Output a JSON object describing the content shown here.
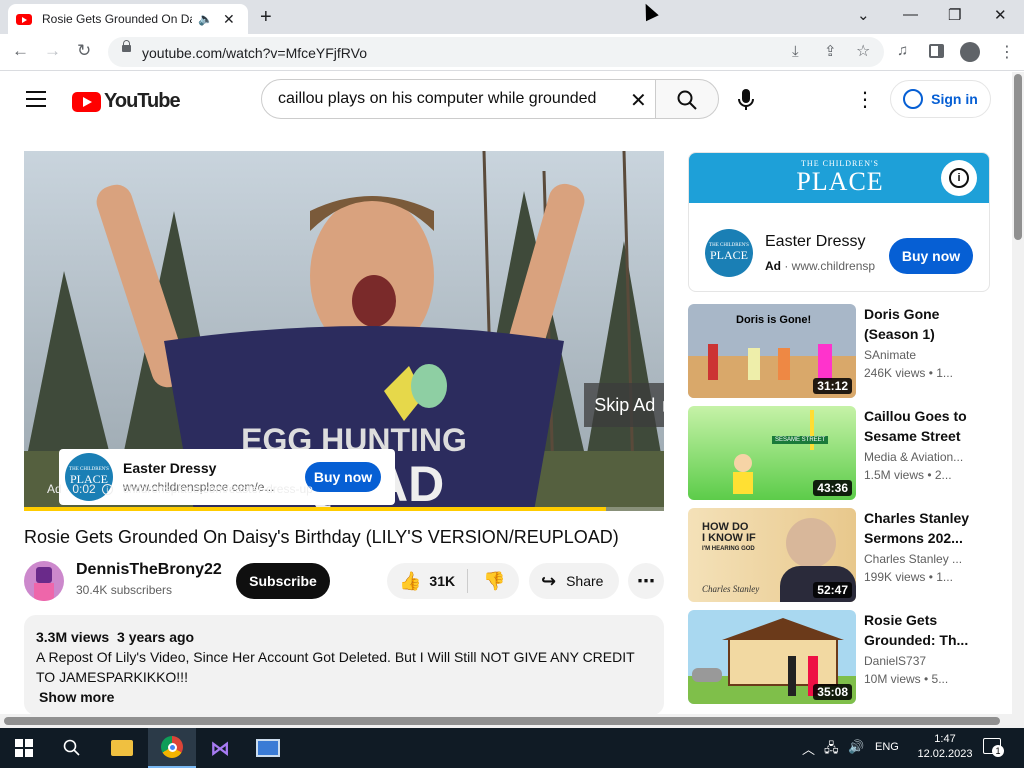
{
  "browser": {
    "tab_title": "Rosie Gets Grounded On Daisy's Birthday",
    "url": "youtube.com/watch?v=MfceYFjfRVo"
  },
  "header": {
    "logo_text": "YouTube",
    "search_value": "caillou plays on his computer while grounded",
    "signin_label": "Sign in"
  },
  "player": {
    "overlay_text_line1": "EGG HUNTING",
    "overlay_text_line2": "SQUAD",
    "skip_label": "Skip Ad",
    "ad_time": "Ad · 0:02",
    "ad_url": "childrensplace.com/easter-dress-up",
    "ad_card": {
      "title": "Easter Dressy",
      "url": "www.childrensplace.com/e...",
      "button": "Buy now"
    },
    "progress": 0.91
  },
  "video": {
    "title": "Rosie Gets Grounded On Daisy's Birthday (LILY'S VERSION/REUPLOAD)",
    "channel": "DennisTheBrony22",
    "subscribers": "30.4K subscribers",
    "subscribe_label": "Subscribe",
    "likes": "31K",
    "share_label": "Share"
  },
  "description": {
    "views": "3.3M views",
    "age": "3 years ago",
    "text": "A Repost Of Lily's Video, Since Her Account Got Deleted. But I Will Still NOT GIVE ANY CREDIT TO JAMESPARKIKKO!!!",
    "show_more": "Show more"
  },
  "side_ad": {
    "brand_top": "THE CHILDREN'S",
    "brand_main": "PLACE",
    "title": "Easter Dressy",
    "ad_label": "Ad",
    "url": "www.childrensp",
    "button": "Buy now"
  },
  "recommendations": [
    {
      "title1": "Doris Gone",
      "title2": "(Season 1)",
      "channel": "SAnimate",
      "meta": "246K views • 1...",
      "duration": "31:12",
      "thumb_text": "Doris is Gone!"
    },
    {
      "title1": "Caillou Goes to",
      "title2": "Sesame Street",
      "channel": "Media & Aviation...",
      "meta": "1.5M views • 2...",
      "duration": "43:36",
      "thumb_text": "SESAME STREET"
    },
    {
      "title1": "Charles Stanley",
      "title2": "Sermons 202...",
      "channel": "Charles Stanley ...",
      "meta": "199K views • 1...",
      "duration": "52:47",
      "thumb_line1": "HOW DO",
      "thumb_line2": "I KNOW IF",
      "thumb_line3": "I'M HEARING GOD",
      "thumb_sig": "Charles Stanley"
    },
    {
      "title1": "Rosie Gets",
      "title2": "Grounded: Th...",
      "channel": "DanielS737",
      "meta": "10M views • 5...",
      "duration": "35:08"
    }
  ],
  "taskbar": {
    "lang": "ENG",
    "time": "1:47",
    "date": "12.02.2023",
    "notif_count": "1"
  }
}
